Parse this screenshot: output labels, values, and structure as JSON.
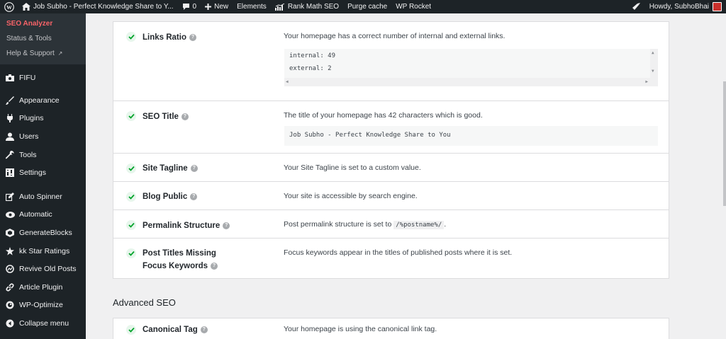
{
  "adminbar": {
    "site_name": "Job Subho - Perfect Knowledge Share to Y...",
    "comments_count": "0",
    "new_label": "New",
    "elements_label": "Elements",
    "rankmath_label": "Rank Math SEO",
    "purge_label": "Purge cache",
    "wprocket_label": "WP Rocket",
    "howdy_label": "Howdy, SubhoBhai"
  },
  "sidebar": {
    "submenu": [
      {
        "label": "SEO Analyzer"
      },
      {
        "label": "Status & Tools"
      },
      {
        "label": "Help & Support"
      }
    ],
    "fifu": "FIFU",
    "items": [
      {
        "label": "Appearance",
        "icon": "brush-icon"
      },
      {
        "label": "Plugins",
        "icon": "plugin-icon"
      },
      {
        "label": "Users",
        "icon": "users-icon"
      },
      {
        "label": "Tools",
        "icon": "wrench-icon"
      },
      {
        "label": "Settings",
        "icon": "settings-icon"
      }
    ],
    "items2": [
      {
        "label": "Auto Spinner",
        "icon": "edit-icon"
      },
      {
        "label": "Automatic",
        "icon": "eye-icon"
      },
      {
        "label": "GenerateBlocks",
        "icon": "blocks-icon"
      },
      {
        "label": "kk Star Ratings",
        "icon": "star-icon"
      },
      {
        "label": "Revive Old Posts",
        "icon": "revive-icon"
      },
      {
        "label": "Article Plugin",
        "icon": "link-icon"
      },
      {
        "label": "WP-Optimize",
        "icon": "optimize-icon"
      },
      {
        "label": "Collapse menu",
        "icon": "collapse-icon"
      }
    ]
  },
  "main": {
    "checks": [
      {
        "title": "Links Ratio",
        "desc": "Your homepage has a correct number of internal and external links.",
        "code": [
          "internal: 49",
          "external: 2"
        ]
      },
      {
        "title": "SEO Title",
        "desc": "The title of your homepage has 42 characters which is good.",
        "code": [
          "Job Subho - Perfect Knowledge Share to You"
        ]
      },
      {
        "title": "Site Tagline",
        "desc": "Your Site Tagline is set to a custom value."
      },
      {
        "title": "Blog Public",
        "desc": "Your site is accessible by search engine."
      },
      {
        "title": "Permalink Structure",
        "desc": "Post permalink structure is set to",
        "code_inline": "/%postname%/",
        "desc_suffix": "."
      },
      {
        "title": "Post Titles Missing Focus Keywords",
        "desc": "Focus keywords appear in the titles of published posts where it is set."
      }
    ],
    "section_heading": "Advanced SEO",
    "advanced": [
      {
        "title": "Canonical Tag",
        "desc": "Your homepage is using the canonical link tag."
      }
    ]
  },
  "colors": {
    "adminbar_bg": "#1d2327",
    "sidebar_bg": "#1d2327",
    "submenu_bg": "#2c3338",
    "current_red": "#f86368",
    "check_green": "#00a32a"
  }
}
